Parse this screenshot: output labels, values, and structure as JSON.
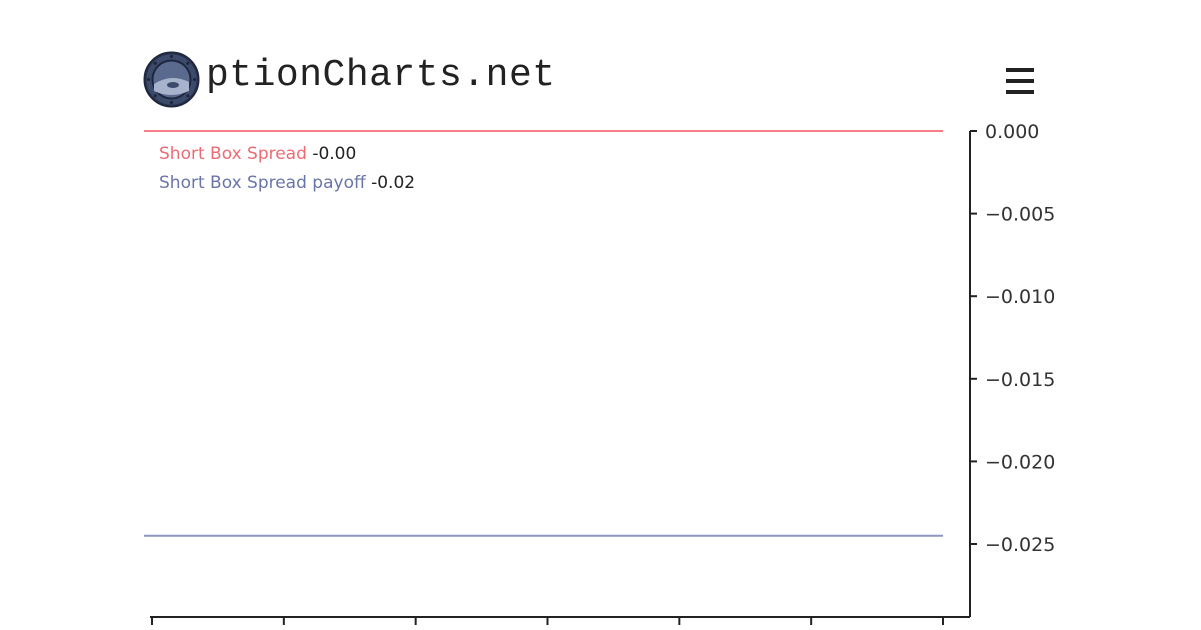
{
  "header": {
    "logo_text": "ptionCharts.net",
    "logo_icon": "porthole-logo-icon",
    "menu_icon": "hamburger-menu-icon"
  },
  "chart_data": {
    "type": "line",
    "y_axis_position": "right",
    "ylim": [
      -0.0292,
      0.0001
    ],
    "y_ticks": [
      0.0,
      -0.005,
      -0.01,
      -0.015,
      -0.02,
      -0.025
    ],
    "y_tick_labels": [
      "0.000",
      "−0.005",
      "−0.010",
      "−0.015",
      "−0.020",
      "−0.025"
    ],
    "x_tick_count": 7,
    "grid": false,
    "series": [
      {
        "name": "Short Box Spread",
        "color": "#f47f88",
        "values": [
          0.0,
          0.0
        ],
        "legend_value": "-0.00"
      },
      {
        "name": "Short Box Spread payoff",
        "color": "#8c96c6",
        "values": [
          -0.0245,
          -0.0245
        ],
        "legend_value": "-0.02"
      }
    ],
    "legend_placement": "top-left"
  },
  "colors": {
    "axis": "#222222",
    "series_label_0": "#ee6b75",
    "series_label_1": "#6975a8"
  }
}
